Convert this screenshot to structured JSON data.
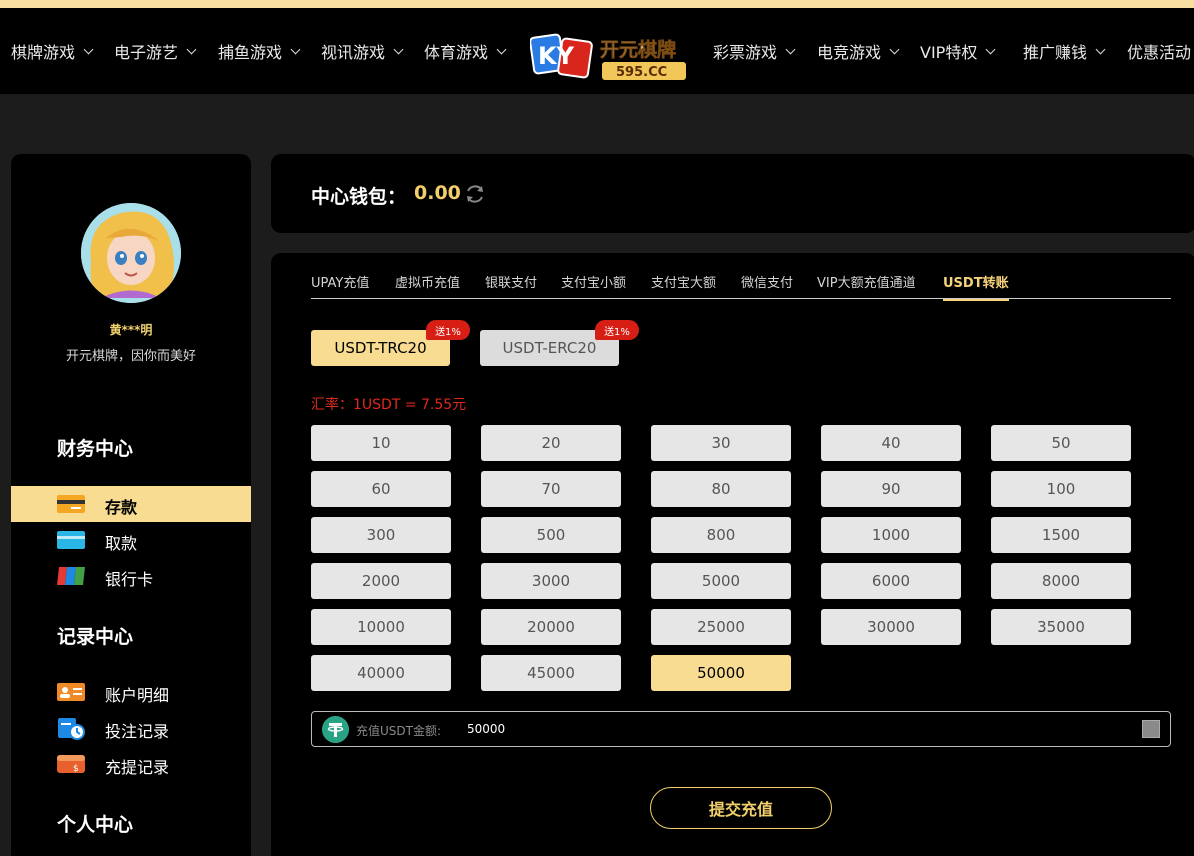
{
  "nav": {
    "items_left": [
      "棋牌游戏",
      "电子游艺",
      "捕鱼游戏",
      "视讯游戏",
      "体育游戏"
    ],
    "items_right": [
      "彩票游戏",
      "电竞游戏",
      "VIP特权",
      "推广赚钱",
      "优惠活动"
    ],
    "logo_text": "开元棋牌",
    "logo_domain": "595.CC",
    "logo_letters": "KY"
  },
  "profile": {
    "username": "黄***明",
    "slogan": "开元棋牌，因你而美好"
  },
  "sidebar": {
    "finance_title": "财务中心",
    "finance_items": [
      {
        "label": "存款",
        "icon": "deposit-card-icon",
        "active": true
      },
      {
        "label": "取款",
        "icon": "withdraw-card-icon",
        "active": false
      },
      {
        "label": "银行卡",
        "icon": "bank-card-icon",
        "active": false
      }
    ],
    "records_title": "记录中心",
    "records_items": [
      {
        "label": "账户明细",
        "icon": "account-detail-icon"
      },
      {
        "label": "投注记录",
        "icon": "bet-record-icon"
      },
      {
        "label": "充提记录",
        "icon": "wallet-record-icon"
      }
    ],
    "personal_title": "个人中心"
  },
  "wallet": {
    "label": "中心钱包：",
    "amount": "0.00"
  },
  "tabs": [
    {
      "label": "UPAY充值",
      "active": false
    },
    {
      "label": "虚拟币充值",
      "active": false
    },
    {
      "label": "银联支付",
      "active": false
    },
    {
      "label": "支付宝小额",
      "active": false
    },
    {
      "label": "支付宝大额",
      "active": false
    },
    {
      "label": "微信支付",
      "active": false
    },
    {
      "label": "VIP大额充值通道",
      "active": false
    },
    {
      "label": "USDT转账",
      "active": true
    }
  ],
  "networks": [
    {
      "label": "USDT-TRC20",
      "bonus": "送1%",
      "selected": true
    },
    {
      "label": "USDT-ERC20",
      "bonus": "送1%",
      "selected": false
    }
  ],
  "rate_text": "汇率：1USDT = 7.55元",
  "amounts": [
    "10",
    "20",
    "30",
    "40",
    "50",
    "60",
    "70",
    "80",
    "90",
    "100",
    "300",
    "500",
    "800",
    "1000",
    "1500",
    "2000",
    "3000",
    "5000",
    "6000",
    "8000",
    "10000",
    "20000",
    "25000",
    "30000",
    "35000",
    "40000",
    "45000",
    "50000"
  ],
  "selected_amount": "50000",
  "input": {
    "label": "充值USDT金额:",
    "value": "50000"
  },
  "submit_label": "提交充值",
  "colors": {
    "accent_gold": "#f8dc92",
    "gold_text": "#f2cf6a",
    "rate_red": "#e0291e",
    "tether_green": "#2aa385"
  }
}
